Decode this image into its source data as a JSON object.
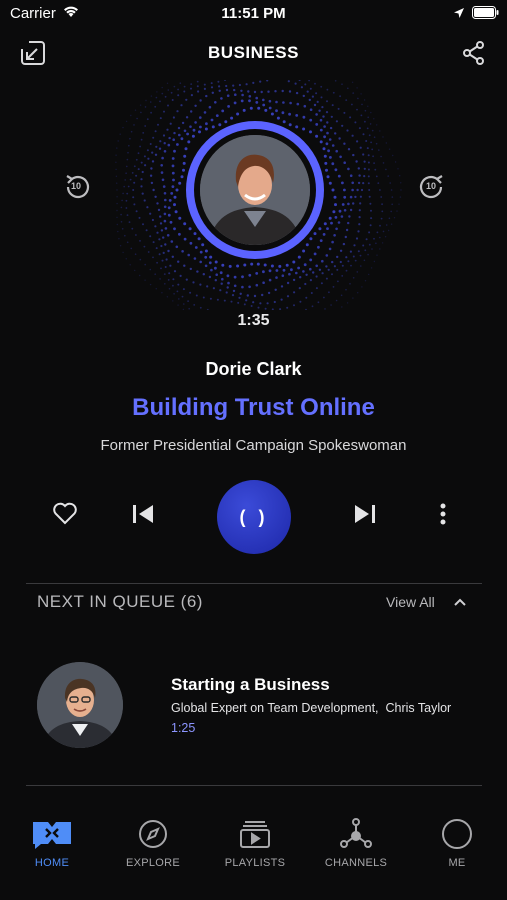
{
  "status": {
    "carrier": "Carrier",
    "time": "11:51 PM"
  },
  "header": {
    "title": "BUSINESS"
  },
  "player": {
    "elapsed": "1:35",
    "speaker": "Dorie Clark",
    "title": "Building Trust Online",
    "role": "Former Presidential Campaign Spokeswoman",
    "rewind_label": "10",
    "forward_label": "10",
    "play_glyph": "( )"
  },
  "queue": {
    "header": "NEXT IN QUEUE (6)",
    "view_all": "View All",
    "items": [
      {
        "title": "Starting a Business",
        "subtitle": "Global Expert on Team Development,  Chris Taylor",
        "duration": "1:25"
      }
    ]
  },
  "tabs": [
    {
      "label": "HOME",
      "icon": "home-icon",
      "active": true
    },
    {
      "label": "EXPLORE",
      "icon": "compass-icon",
      "active": false
    },
    {
      "label": "PLAYLISTS",
      "icon": "playlist-icon",
      "active": false
    },
    {
      "label": "CHANNELS",
      "icon": "channels-icon",
      "active": false
    },
    {
      "label": "ME",
      "icon": "profile-icon",
      "active": false
    }
  ],
  "colors": {
    "accent": "#6470ff",
    "tab_active": "#4f8df7",
    "background": "#0b0b0c"
  }
}
